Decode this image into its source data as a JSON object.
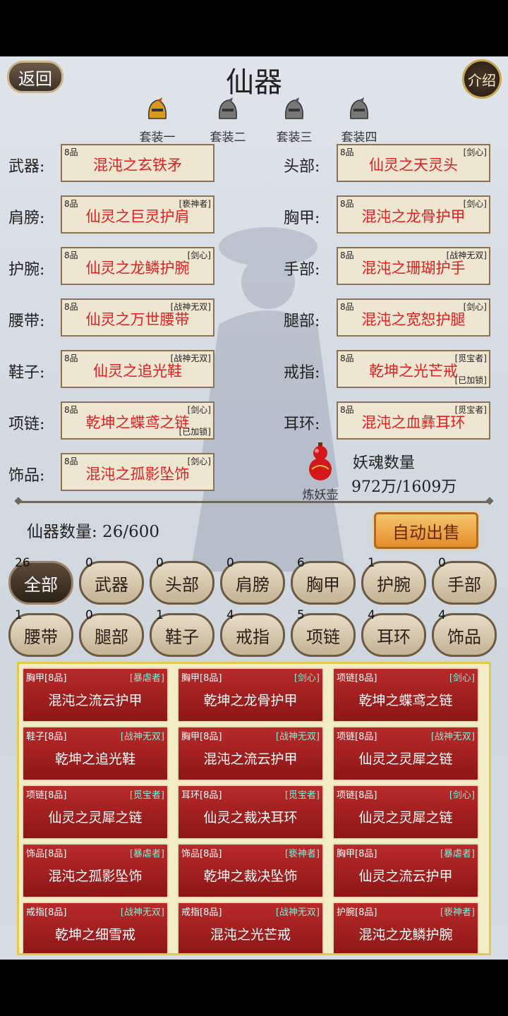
{
  "header": {
    "back_label": "返回",
    "title": "仙器",
    "intro_label": "介绍"
  },
  "set_tabs": [
    "套装一",
    "套装二",
    "套装三",
    "套装四"
  ],
  "slots_left": [
    {
      "label": "武器:",
      "grade": "8品",
      "tag": "",
      "name": "混沌之玄铁矛",
      "lock": ""
    },
    {
      "label": "肩膀:",
      "grade": "8品",
      "tag": "[亵神者]",
      "name": "仙灵之巨灵护肩",
      "lock": ""
    },
    {
      "label": "护腕:",
      "grade": "8品",
      "tag": "[剑心]",
      "name": "仙灵之龙鳞护腕",
      "lock": ""
    },
    {
      "label": "腰带:",
      "grade": "8品",
      "tag": "[战神无双]",
      "name": "仙灵之万世腰带",
      "lock": ""
    },
    {
      "label": "鞋子:",
      "grade": "8品",
      "tag": "[战神无双]",
      "name": "仙灵之追光鞋",
      "lock": ""
    },
    {
      "label": "项链:",
      "grade": "8品",
      "tag": "[剑心]",
      "name": "乾坤之蝶鸢之链",
      "lock": "[已加锁]"
    },
    {
      "label": "饰品:",
      "grade": "8品",
      "tag": "[剑心]",
      "name": "混沌之孤影坠饰",
      "lock": ""
    }
  ],
  "slots_right": [
    {
      "label": "头部:",
      "grade": "8品",
      "tag": "[剑心]",
      "name": "仙灵之天灵头",
      "lock": ""
    },
    {
      "label": "胸甲:",
      "grade": "8品",
      "tag": "[剑心]",
      "name": "混沌之龙骨护甲",
      "lock": ""
    },
    {
      "label": "手部:",
      "grade": "8品",
      "tag": "[战神无双]",
      "name": "混沌之珊瑚护手",
      "lock": ""
    },
    {
      "label": "腿部:",
      "grade": "8品",
      "tag": "[剑心]",
      "name": "混沌之宽恕护腿",
      "lock": ""
    },
    {
      "label": "戒指:",
      "grade": "8品",
      "tag": "[觅宝者]",
      "name": "乾坤之光芒戒",
      "lock": "[已加锁]"
    },
    {
      "label": "耳环:",
      "grade": "8品",
      "tag": "[觅宝者]",
      "name": "混沌之血彝耳环",
      "lock": ""
    }
  ],
  "refiner": {
    "label": "炼妖壶",
    "soul_title": "妖魂数量",
    "soul_value": "972万/1609万"
  },
  "inventory": {
    "count_label": "仙器数量: 26/600",
    "sell_label": "自动出售"
  },
  "filters": [
    {
      "label": "全部",
      "count": "26"
    },
    {
      "label": "武器",
      "count": "0"
    },
    {
      "label": "头部",
      "count": "0"
    },
    {
      "label": "肩膀",
      "count": "0"
    },
    {
      "label": "胸甲",
      "count": "6"
    },
    {
      "label": "护腕",
      "count": "1"
    },
    {
      "label": "手部",
      "count": "0"
    },
    {
      "label": "腰带",
      "count": "1"
    },
    {
      "label": "腿部",
      "count": "0"
    },
    {
      "label": "鞋子",
      "count": "1"
    },
    {
      "label": "戒指",
      "count": "4"
    },
    {
      "label": "项链",
      "count": "5"
    },
    {
      "label": "耳环",
      "count": "4"
    },
    {
      "label": "饰品",
      "count": "4"
    }
  ],
  "items": [
    {
      "cat": "胸甲[8品]",
      "tag": "[暴虐者]",
      "name": "混沌之流云护甲"
    },
    {
      "cat": "胸甲[8品]",
      "tag": "[剑心]",
      "name": "乾坤之龙骨护甲"
    },
    {
      "cat": "项链[8品]",
      "tag": "[剑心]",
      "name": "乾坤之蝶鸢之链"
    },
    {
      "cat": "鞋子[8品]",
      "tag": "[战神无双]",
      "name": "乾坤之追光鞋"
    },
    {
      "cat": "胸甲[8品]",
      "tag": "[战神无双]",
      "name": "混沌之流云护甲"
    },
    {
      "cat": "项链[8品]",
      "tag": "[战神无双]",
      "name": "仙灵之灵犀之链"
    },
    {
      "cat": "项链[8品]",
      "tag": "[觅宝者]",
      "name": "仙灵之灵犀之链"
    },
    {
      "cat": "耳环[8品]",
      "tag": "[觅宝者]",
      "name": "仙灵之裁决耳环"
    },
    {
      "cat": "项链[8品]",
      "tag": "[剑心]",
      "name": "仙灵之灵犀之链"
    },
    {
      "cat": "饰品[8品]",
      "tag": "[暴虐者]",
      "name": "混沌之孤影坠饰"
    },
    {
      "cat": "饰品[8品]",
      "tag": "[亵神者]",
      "name": "乾坤之裁决坠饰"
    },
    {
      "cat": "胸甲[8品]",
      "tag": "[暴虐者]",
      "name": "仙灵之流云护甲"
    },
    {
      "cat": "戒指[8品]",
      "tag": "[战神无双]",
      "name": "乾坤之细雪戒"
    },
    {
      "cat": "戒指[8品]",
      "tag": "[战神无双]",
      "name": "混沌之光芒戒"
    },
    {
      "cat": "护腕[8品]",
      "tag": "[亵神者]",
      "name": "混沌之龙鳞护腕"
    }
  ],
  "colors": {
    "item_red": "#e02020",
    "card_bg": "#a21f1f",
    "tag_cyan": "#7ff0d8",
    "panel_border": "#e2c84c"
  }
}
